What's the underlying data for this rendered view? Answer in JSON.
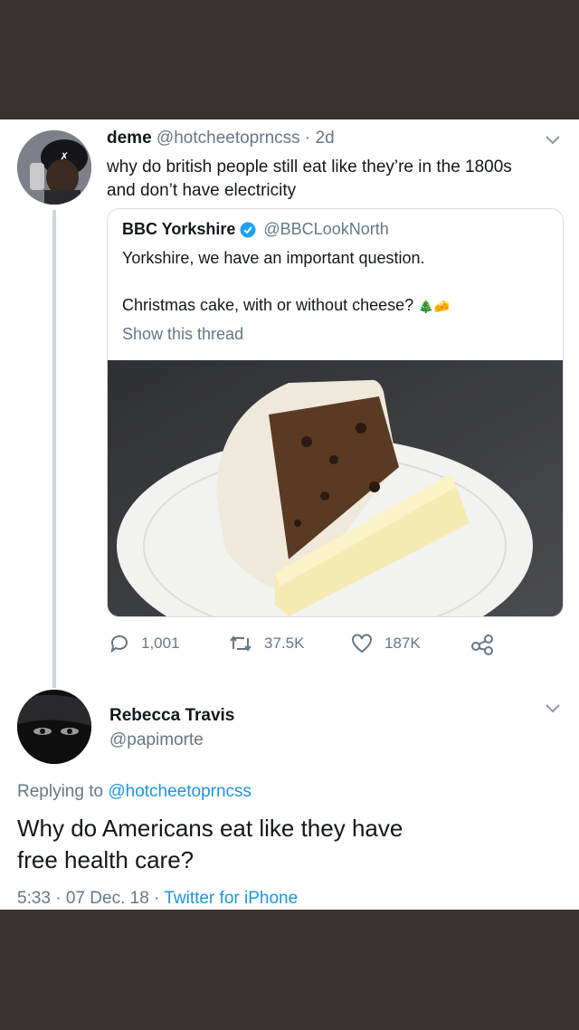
{
  "tweet1": {
    "name": "deme",
    "handle": "@hotcheetoprncss",
    "sep": "·",
    "time": "2d",
    "text_line1": "why do british people still eat like they’re in the 1800s",
    "text_line2": "and don’t have electricity"
  },
  "quote": {
    "name": "BBC Yorkshire",
    "handle": "@BBCLookNorth",
    "text_line1": "Yorkshire, we have an important question.",
    "text_line2": "Christmas cake, with or without cheese?",
    "emoji": "🎄🧀",
    "show_thread": "Show this thread"
  },
  "actions": {
    "replies": "1,001",
    "retweets": "37.5K",
    "likes": "187K"
  },
  "tweet2": {
    "name": "Rebecca Travis",
    "handle": "@papimorte",
    "replying_prefix": "Replying to",
    "replying_handle": "@hotcheetoprncss",
    "text_line1": "Why do Americans eat like they have",
    "text_line2": "free health care?",
    "meta": "5:33 · 07 Dec. 18 ·",
    "source": "Twitter for iPhone"
  },
  "icons": [
    "chevron-down-icon",
    "verified-badge-icon",
    "reply-icon",
    "retweet-icon",
    "like-icon",
    "share-icon"
  ],
  "colors": {
    "accent": "#1b95e0",
    "muted": "#657786",
    "background": "#3a3230"
  }
}
